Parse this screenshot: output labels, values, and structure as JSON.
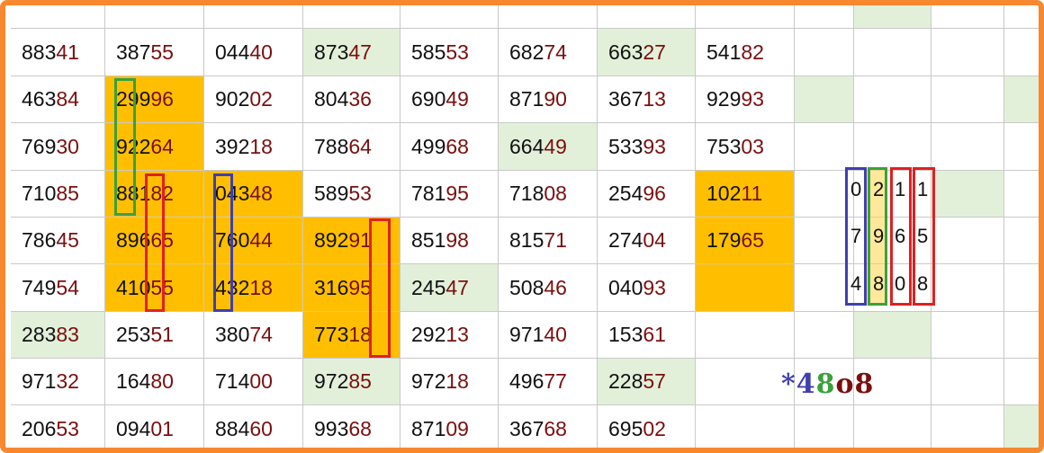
{
  "colors": {
    "border": "#f7882f",
    "orange": "#ffbf00",
    "green": "#e2f0d9",
    "blue": "#3f3fb0",
    "greenBox": "#3aa13a",
    "red": "#e02020",
    "dark": "#111111",
    "darkred": "#7a0f0f"
  },
  "rows": [
    [
      [
        "883",
        "41"
      ],
      [
        "387",
        "55"
      ],
      [
        "044",
        "40"
      ],
      [
        "873",
        "47"
      ],
      [
        "585",
        "53"
      ],
      [
        "682",
        "74"
      ],
      [
        "663",
        "27"
      ],
      [
        "541",
        "82"
      ]
    ],
    [
      [
        "463",
        "84"
      ],
      [
        "299",
        "96"
      ],
      [
        "902",
        "02"
      ],
      [
        "804",
        "36"
      ],
      [
        "690",
        "49"
      ],
      [
        "871",
        "90"
      ],
      [
        "367",
        "13"
      ],
      [
        "929",
        "93"
      ]
    ],
    [
      [
        "769",
        "30"
      ],
      [
        "922",
        "64"
      ],
      [
        "392",
        "18"
      ],
      [
        "788",
        "64"
      ],
      [
        "499",
        "68"
      ],
      [
        "664",
        "49"
      ],
      [
        "533",
        "93"
      ],
      [
        "753",
        "03"
      ]
    ],
    [
      [
        "710",
        "85"
      ],
      [
        "881",
        "82"
      ],
      [
        "043",
        "48"
      ],
      [
        "589",
        "53"
      ],
      [
        "781",
        "95"
      ],
      [
        "718",
        "08"
      ],
      [
        "254",
        "96"
      ],
      [
        "102",
        "11"
      ]
    ],
    [
      [
        "786",
        "45"
      ],
      [
        "896",
        "65"
      ],
      [
        "760",
        "44"
      ],
      [
        "892",
        "91"
      ],
      [
        "851",
        "98"
      ],
      [
        "815",
        "71"
      ],
      [
        "274",
        "04"
      ],
      [
        "179",
        "65"
      ]
    ],
    [
      [
        "749",
        "54"
      ],
      [
        "410",
        "55"
      ],
      [
        "432",
        "18"
      ],
      [
        "316",
        "95"
      ],
      [
        "245",
        "47"
      ],
      [
        "508",
        "46"
      ],
      [
        "040",
        "93"
      ],
      [
        "",
        ""
      ]
    ],
    [
      [
        "283",
        "83"
      ],
      [
        "253",
        "51"
      ],
      [
        "380",
        "74"
      ],
      [
        "773",
        "18"
      ],
      [
        "292",
        "13"
      ],
      [
        "971",
        "40"
      ],
      [
        "153",
        "61"
      ],
      [
        "",
        ""
      ]
    ],
    [
      [
        "971",
        "32"
      ],
      [
        "164",
        "80"
      ],
      [
        "714",
        "00"
      ],
      [
        "972",
        "85"
      ],
      [
        "972",
        "18"
      ],
      [
        "496",
        "77"
      ],
      [
        "228",
        "57"
      ],
      [
        "",
        ""
      ]
    ],
    [
      [
        "206",
        "53"
      ],
      [
        "094",
        "01"
      ],
      [
        "884",
        "60"
      ],
      [
        "993",
        "68"
      ],
      [
        "871",
        "09"
      ],
      [
        "367",
        "68"
      ],
      [
        "695",
        "02"
      ],
      [
        "",
        ""
      ]
    ]
  ],
  "side_columns": [
    [
      "0",
      "7",
      "4"
    ],
    [
      "2",
      "9",
      "8"
    ],
    [
      "1",
      "6",
      "0"
    ],
    [
      "1",
      "5",
      "8"
    ]
  ],
  "result": {
    "star": "*",
    "d1": "4",
    "d2": "8",
    "d3": "o",
    "d4": "8"
  }
}
